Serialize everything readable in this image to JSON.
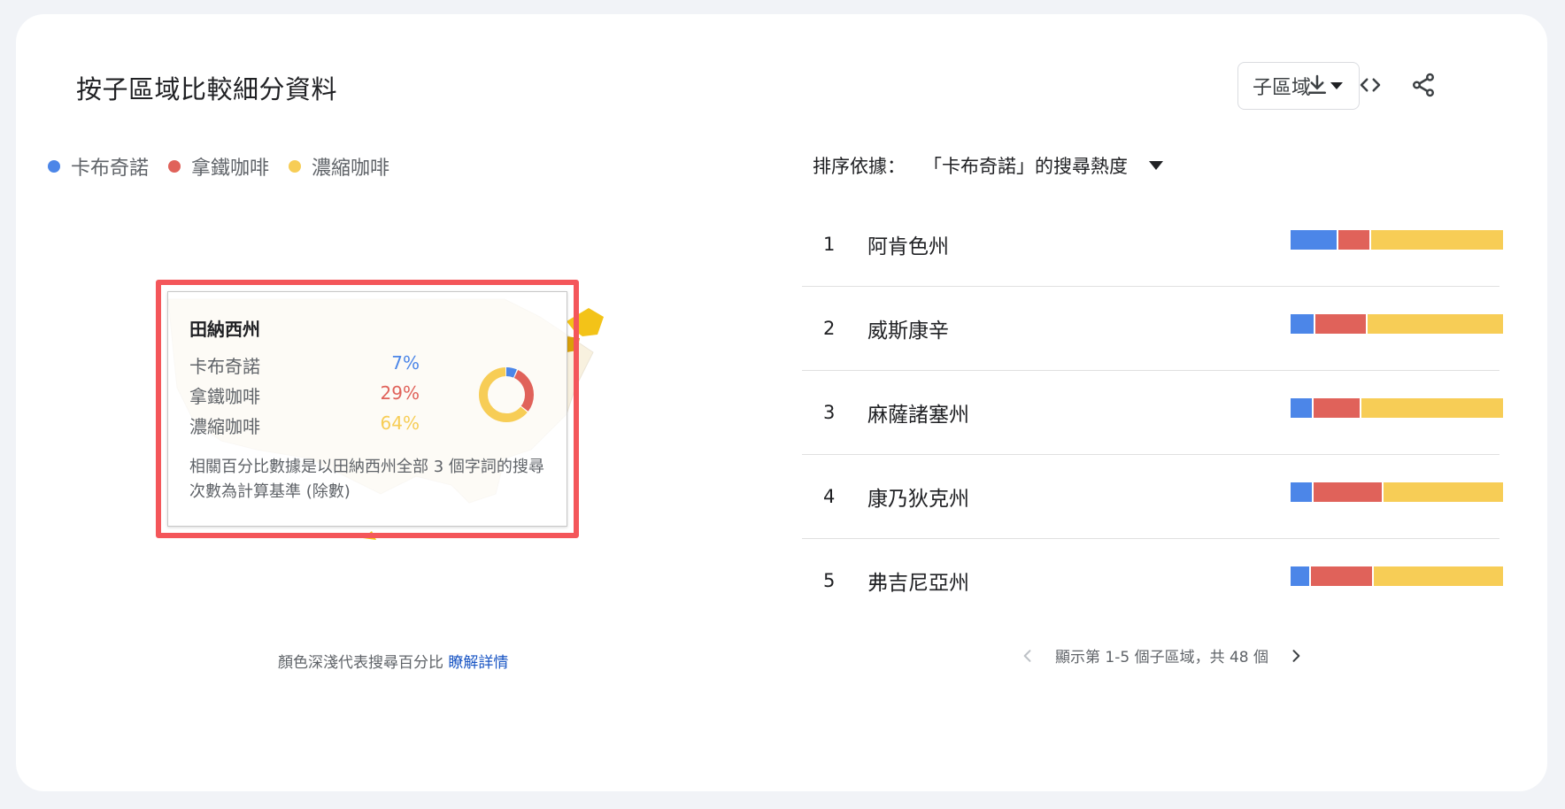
{
  "header": {
    "title": "按子區域比較細分資料"
  },
  "toolbar": {
    "region_select": "子區域",
    "icons": [
      "download-icon",
      "embed-code-icon",
      "share-icon"
    ]
  },
  "colors": {
    "blue": "#4c86e8",
    "red": "#e0625a",
    "yellow": "#f7cd56"
  },
  "legend": [
    {
      "label": "卡布奇諾",
      "color": "#4c86e8"
    },
    {
      "label": "拿鐵咖啡",
      "color": "#e0625a"
    },
    {
      "label": "濃縮咖啡",
      "color": "#f7cd56"
    }
  ],
  "tooltip": {
    "region": "田納西州",
    "rows": [
      {
        "label": "卡布奇諾",
        "pct": "7%",
        "value": 7,
        "color": "#4c86e8"
      },
      {
        "label": "拿鐵咖啡",
        "pct": "29%",
        "value": 29,
        "color": "#e0625a"
      },
      {
        "label": "濃縮咖啡",
        "pct": "64%",
        "value": 64,
        "color": "#f7cd56"
      }
    ],
    "note": "相關百分比數據是以田納西州全部 3 個字詞的搜尋次數為計算基準 (除數)"
  },
  "map_caption": {
    "text": "顏色深淺代表搜尋百分比 ",
    "link": "瞭解詳情"
  },
  "sort": {
    "label": "排序依據：",
    "value": "「卡布奇諾」的搜尋熱度"
  },
  "ranks": [
    {
      "num": "1",
      "name": "阿肯色州",
      "shares": [
        22,
        15,
        63
      ]
    },
    {
      "num": "2",
      "name": "威斯康辛",
      "shares": [
        11,
        24,
        65
      ]
    },
    {
      "num": "3",
      "name": "麻薩諸塞州",
      "shares": [
        10,
        22,
        68
      ]
    },
    {
      "num": "4",
      "name": "康乃狄克州",
      "shares": [
        10,
        33,
        57
      ]
    },
    {
      "num": "5",
      "name": "弗吉尼亞州",
      "shares": [
        9,
        29,
        62
      ]
    }
  ],
  "pager": {
    "text": "顯示第 1-5 個子區域，共 48 個"
  }
}
